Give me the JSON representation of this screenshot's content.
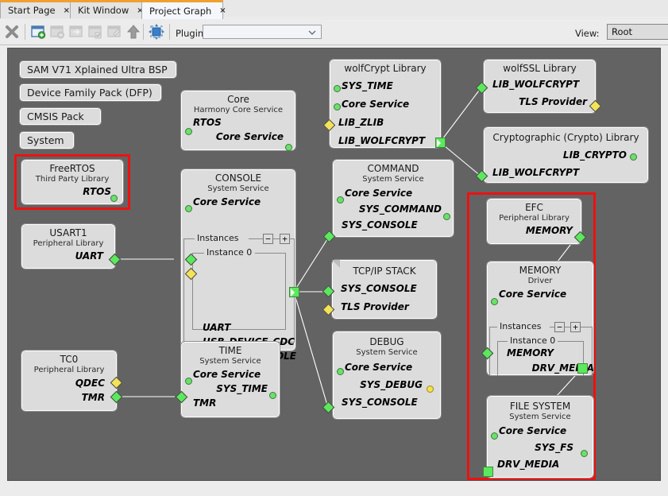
{
  "window": {
    "tabs": [
      {
        "label": "Start Page",
        "close": "×",
        "active": false
      },
      {
        "label": "Kit Window",
        "close": "×",
        "active": false
      },
      {
        "label": "Project Graph",
        "close": "×",
        "active": true
      }
    ]
  },
  "toolbar": {
    "icons": [
      {
        "name": "close-graph-icon",
        "glyph": "✖"
      },
      {
        "name": "new-window-icon",
        "glyph": ""
      },
      {
        "name": "remove-window-icon",
        "glyph": ""
      },
      {
        "name": "enter-window-icon",
        "glyph": ""
      },
      {
        "name": "check-window-icon",
        "glyph": ""
      },
      {
        "name": "edit-window-icon",
        "glyph": ""
      },
      {
        "name": "move-up-icon",
        "glyph": "⬆"
      },
      {
        "name": "fit-to-view-icon",
        "glyph": ""
      }
    ],
    "plugins_label": "Plugins:",
    "plugins_value": "",
    "view_label": "View:",
    "view_value": "Root"
  },
  "palette": {
    "accent_orange": "#f0a030",
    "canvas_gray": "#636363",
    "node_fill": "#dcdcdc",
    "highlight_red": "#ee1111",
    "green": "#5ce85c",
    "yellow": "#f2e35a"
  },
  "pills": [
    {
      "label": "SAM V71 Xplained Ultra BSP"
    },
    {
      "label": "Device Family Pack (DFP)"
    },
    {
      "label": "CMSIS Pack"
    },
    {
      "label": "System"
    }
  ],
  "nodes": {
    "freertos": {
      "title": "FreeRTOS",
      "sub": "Third Party Library",
      "rows": [
        "RTOS"
      ]
    },
    "usart1": {
      "title": "USART1",
      "sub": "Peripheral Library",
      "rows": [
        "UART"
      ]
    },
    "tc0": {
      "title": "TC0",
      "sub": "Peripheral Library",
      "rows": [
        "QDEC",
        "TMR"
      ]
    },
    "core": {
      "title": "Core",
      "sub": "Harmony Core Service",
      "rows": [
        "RTOS",
        "Core Service"
      ]
    },
    "console": {
      "title": "CONSOLE",
      "sub": "System Service",
      "rows": [
        "Core Service"
      ],
      "instances_label": "Instances",
      "minus": "−",
      "plus": "+",
      "instance_label": "Instance 0",
      "instance_rows": [
        "UART",
        "USB_DEVICE_CDC",
        "SYS_CONSOLE"
      ]
    },
    "time": {
      "title": "TIME",
      "sub": "System Service",
      "rows": [
        "Core Service",
        "SYS_TIME",
        "TMR"
      ]
    },
    "wolfcrypt": {
      "title": "wolfCrypt Library",
      "sub": "",
      "rows": [
        "SYS_TIME",
        "Core Service",
        "LIB_ZLIB",
        "LIB_WOLFCRYPT"
      ]
    },
    "command": {
      "title": "COMMAND",
      "sub": "System Service",
      "rows": [
        "Core Service",
        "SYS_COMMAND",
        "SYS_CONSOLE"
      ]
    },
    "tcpip": {
      "title": "TCP/IP STACK",
      "sub": "",
      "rows": [
        "SYS_CONSOLE",
        "TLS Provider"
      ]
    },
    "debug": {
      "title": "DEBUG",
      "sub": "System Service",
      "rows": [
        "Core Service",
        "SYS_DEBUG",
        "SYS_CONSOLE"
      ]
    },
    "wolfssl": {
      "title": "wolfSSL Library",
      "sub": "",
      "rows": [
        "LIB_WOLFCRYPT",
        "TLS Provider"
      ]
    },
    "crypto": {
      "title": "Cryptographic (Crypto) Library",
      "sub": "",
      "rows": [
        "LIB_CRYPTO",
        "LIB_WOLFCRYPT"
      ]
    },
    "efc": {
      "title": "EFC",
      "sub": "Peripheral Library",
      "rows": [
        "MEMORY"
      ]
    },
    "memory": {
      "title": "MEMORY",
      "sub": "Driver",
      "rows": [
        "Core Service"
      ],
      "instances_label": "Instances",
      "minus": "−",
      "plus": "+",
      "instance_label": "Instance 0",
      "instance_rows": [
        "MEMORY",
        "DRV_MEDIA"
      ]
    },
    "filesystem": {
      "title": "FILE SYSTEM",
      "sub": "System Service",
      "rows": [
        "Core Service",
        "SYS_FS",
        "DRV_MEDIA"
      ]
    }
  }
}
